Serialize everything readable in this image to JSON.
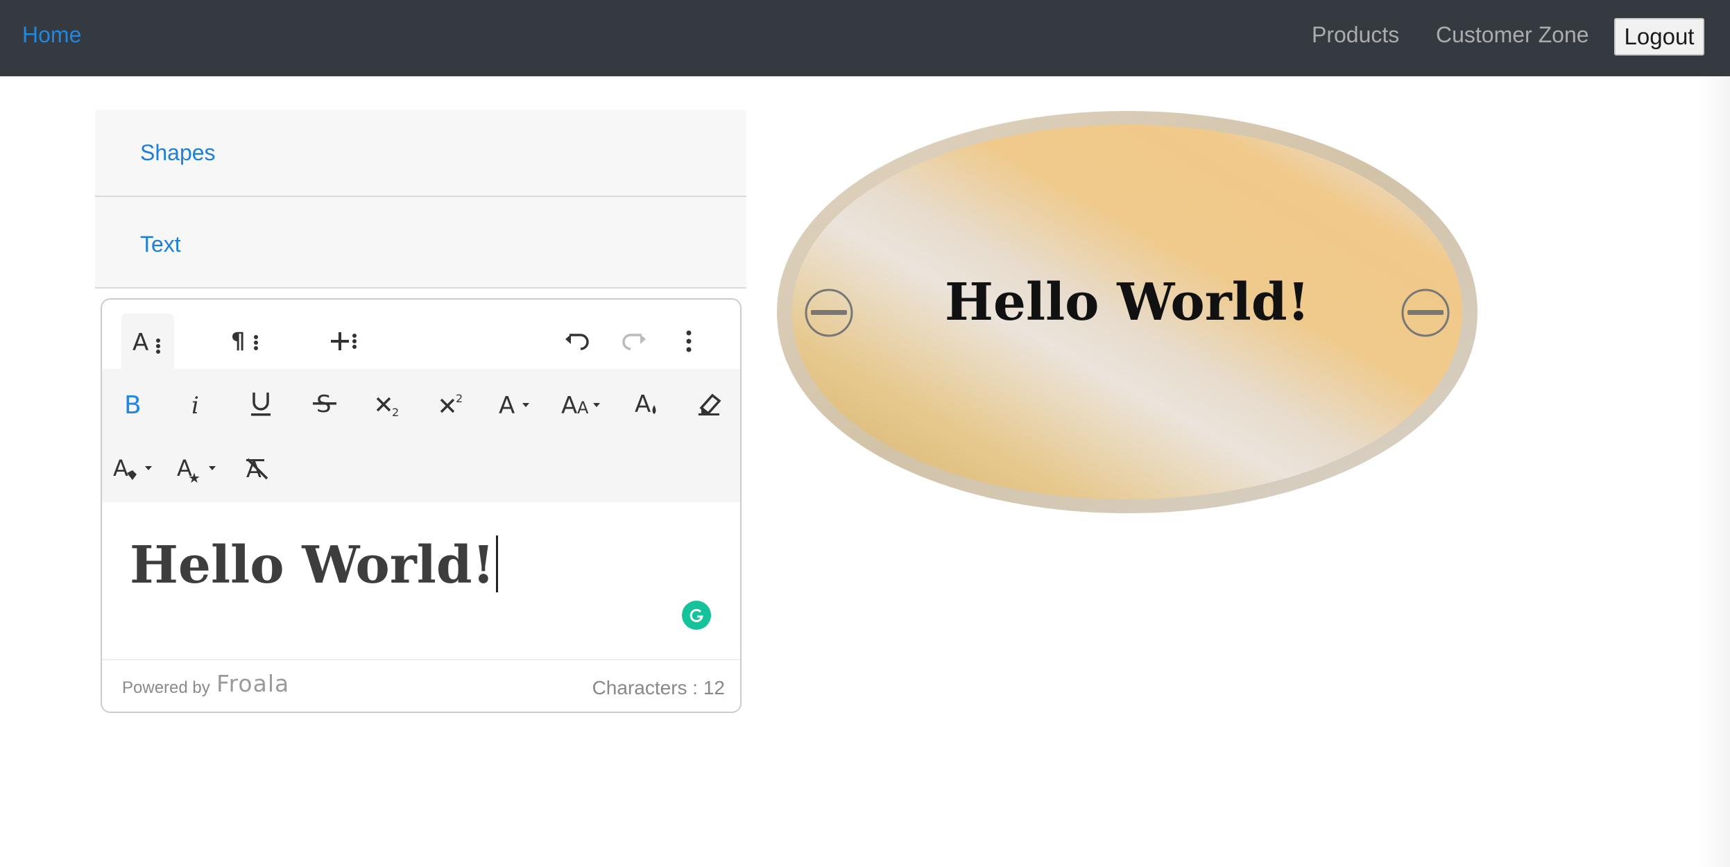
{
  "navbar": {
    "home_label": "Home",
    "products_label": "Products",
    "customer_zone_label": "Customer Zone",
    "logout_label": "Logout",
    "accent_color": "#1e88e5",
    "background_color": "#343a40"
  },
  "accordion": {
    "items": [
      {
        "label": "Shapes"
      },
      {
        "label": "Text"
      }
    ]
  },
  "editor": {
    "toolbar_row1": [
      {
        "name": "text-format-more-icon",
        "active": true
      },
      {
        "name": "paragraph-more-icon"
      },
      {
        "name": "insert-more-icon"
      },
      {
        "name": "undo-icon"
      },
      {
        "name": "redo-icon",
        "disabled": true
      },
      {
        "name": "more-options-icon"
      }
    ],
    "toolbar_row2": [
      {
        "name": "bold-icon",
        "active": true
      },
      {
        "name": "italic-icon"
      },
      {
        "name": "underline-icon"
      },
      {
        "name": "strikethrough-icon"
      },
      {
        "name": "subscript-icon"
      },
      {
        "name": "superscript-icon"
      },
      {
        "name": "font-family-icon"
      },
      {
        "name": "font-size-icon"
      },
      {
        "name": "text-color-icon"
      },
      {
        "name": "highlight-icon"
      },
      {
        "name": "inline-class-icon"
      },
      {
        "name": "inline-style-icon"
      },
      {
        "name": "clear-formatting-icon"
      }
    ],
    "content_text": "Hello World!",
    "powered_by": "Powered by",
    "brand": "Froala",
    "character_count": "Characters : 12"
  },
  "tag_shape": {
    "text": "Hello World!",
    "colors": {
      "gold": "#e8c27f",
      "silver": "#e7e1da",
      "rim": "#d6cbbb"
    }
  }
}
